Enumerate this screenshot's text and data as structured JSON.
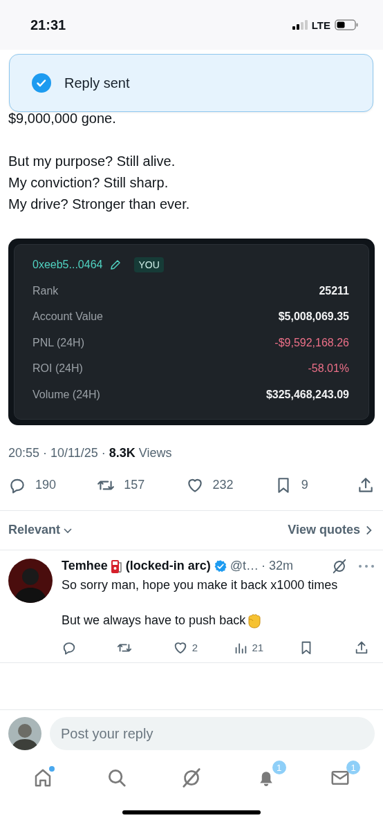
{
  "status_bar": {
    "time": "21:31",
    "network": "LTE"
  },
  "toast": {
    "text": "Reply sent"
  },
  "post": {
    "paragraphs": [
      "$9,000,000 gone.",
      "But my purpose? Still alive.\nMy conviction? Still sharp.\nMy drive? Stronger than ever."
    ],
    "card": {
      "address": "0xeeb5...0464",
      "badge": "YOU",
      "rows": [
        {
          "label": "Rank",
          "value": "25211",
          "negative": false
        },
        {
          "label": "Account Value",
          "value": "$5,008,069.35",
          "negative": false
        },
        {
          "label": "PNL (24H)",
          "value": "-$9,592,168.26",
          "negative": true
        },
        {
          "label": "ROI (24H)",
          "value": "-58.01%",
          "negative": true
        },
        {
          "label": "Volume (24H)",
          "value": "$325,468,243.09",
          "negative": false
        }
      ]
    },
    "meta": "20:55 · 10/11/25 · **8.3K** Views",
    "actions": [
      {
        "kind": "reply",
        "count": "190"
      },
      {
        "kind": "repost",
        "count": "157"
      },
      {
        "kind": "like",
        "count": "232"
      },
      {
        "kind": "bookmark",
        "count": "9"
      },
      {
        "kind": "share"
      }
    ]
  },
  "sort": {
    "label": "Relevant"
  },
  "quotes_link": "View quotes",
  "replies": [
    {
      "name": "Temhee",
      "name_suffix": "(locked-in arc)",
      "verified": true,
      "handle": "@t…",
      "time": "· 32m",
      "paragraphs": [
        "So sorry man, hope you make it back x1000 times",
        "But we always have to push back"
      ],
      "actions": [
        {
          "kind": "reply"
        },
        {
          "kind": "repost"
        },
        {
          "kind": "like",
          "count": "2"
        },
        {
          "kind": "views",
          "count": "21"
        },
        {
          "kind": "bookmark"
        },
        {
          "kind": "share"
        }
      ]
    }
  ],
  "composer": {
    "placeholder": "Post your reply"
  },
  "nav": [
    {
      "kind": "home",
      "unread": true
    },
    {
      "kind": "search",
      "unread": false
    },
    {
      "kind": "grok",
      "unread": false
    },
    {
      "kind": "notifications",
      "unread": false,
      "badge": "1"
    },
    {
      "kind": "messages",
      "unread": false,
      "badge": "1"
    }
  ]
}
